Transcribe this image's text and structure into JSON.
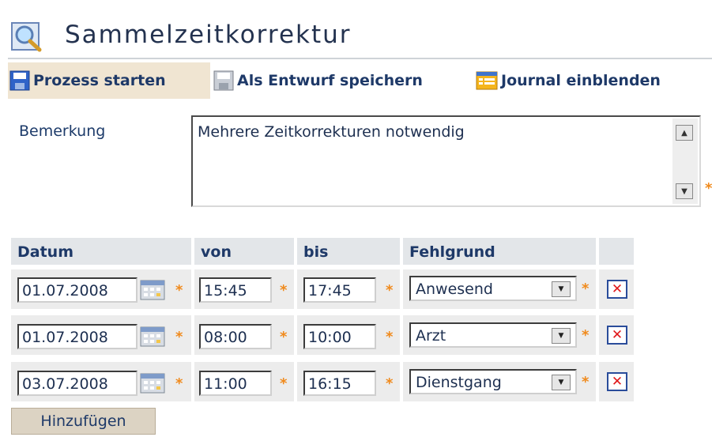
{
  "window": {
    "title": "Sammelzeitkorrektur"
  },
  "toolbar": {
    "start_label": "Prozess starten",
    "draft_label": "Als Entwurf speichern",
    "journal_label": "Journal einblenden"
  },
  "remark": {
    "label": "Bemerkung",
    "value": "Mehrere Zeitkorrekturen notwendig"
  },
  "table": {
    "headers": [
      "Datum",
      "von",
      "bis",
      "Fehlgrund"
    ],
    "rows": [
      {
        "date": "01.07.2008",
        "from": "15:45",
        "to": "17:45",
        "reason": "Anwesend"
      },
      {
        "date": "01.07.2008",
        "from": "08:00",
        "to": "10:00",
        "reason": "Arzt"
      },
      {
        "date": "03.07.2008",
        "from": "11:00",
        "to": "16:15",
        "reason": "Dienstgang"
      }
    ]
  },
  "add_label": "Hinzufügen",
  "colors": {
    "accent": "#1e3968",
    "required": "#f08a1c",
    "delete": "#e0181a",
    "active_tab": "#f0e5d2"
  }
}
